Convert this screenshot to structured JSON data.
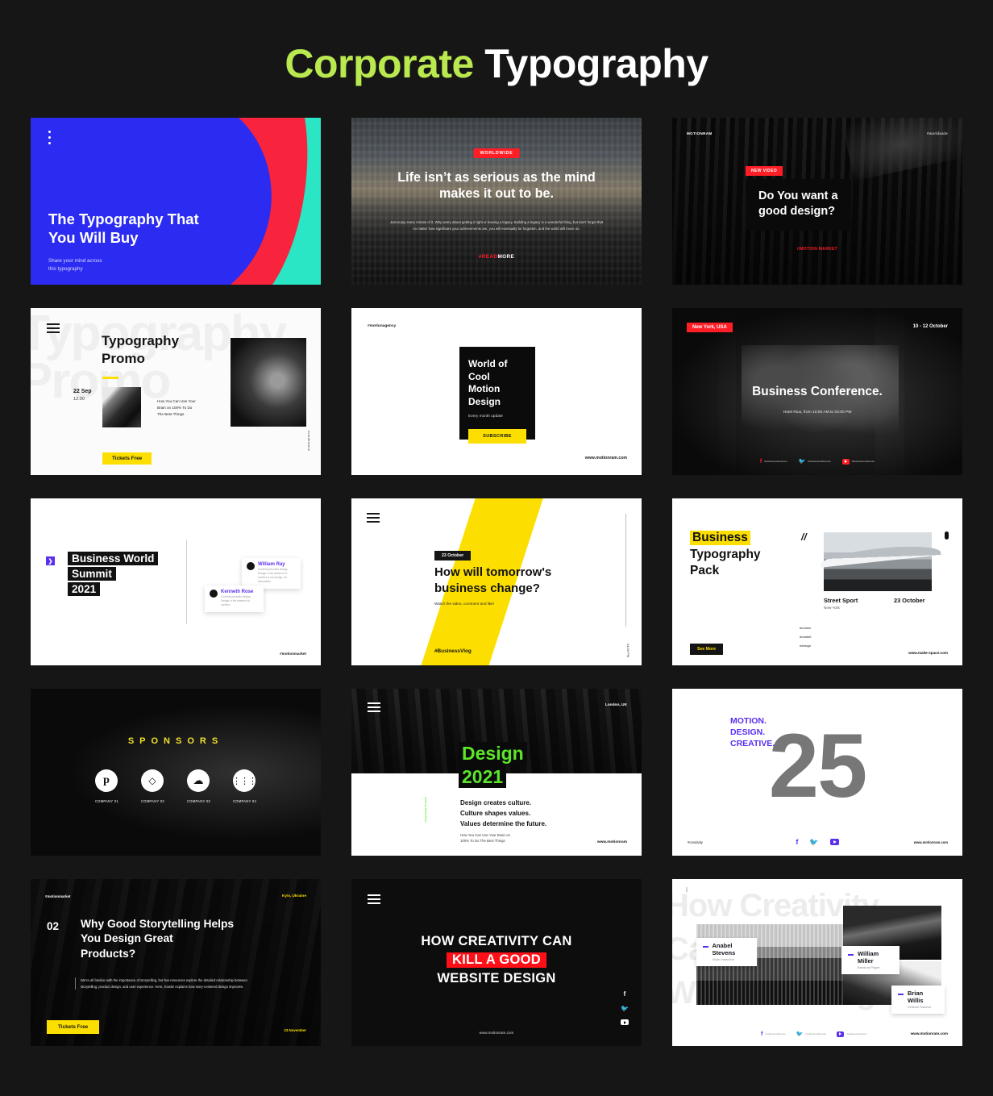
{
  "page": {
    "title_accent": "Corporate",
    "title_plain": "Typography",
    "accent_color": "#b9e94f",
    "background": "#161616"
  },
  "slides": [
    {
      "id": "typography-that-you-will-buy",
      "menu_icon": "vertical-dots-icon",
      "headline": "The Typography That\nYou Will Buy",
      "subtext": "Share your mind across\nthis typography",
      "colors": {
        "bg": "#2b2bf2",
        "shape_red": "#f8233c",
        "shape_teal": "#2ae6c4"
      }
    },
    {
      "id": "life-isnt-as-serious",
      "badge": "WORLDWIDE",
      "headline": "Life isn’t as serious as the mind\nmakes it out to be.",
      "body": "Just enjoy every minute of it. Why worry about getting it right or leaving a legacy. Building a legacy is a wonderful thing, but don’t forget that no matter how significant your achievements are, you will eventually be forgotten, and the world will move on.",
      "cta_accent": "#READ",
      "cta_plain": "MORE",
      "badge_color": "#ff1d26"
    },
    {
      "id": "do-you-want-a-good-design",
      "brand": "MOTIONRAM",
      "tag": "#worldwide",
      "badge": "NEW VIDEO",
      "headline": "Do You want a\ngood design?",
      "footer": "//MOTION MARKET",
      "badge_color": "#ff1d26"
    },
    {
      "id": "typography-promo",
      "menu_icon": "hamburger-icon",
      "watermark": "Typography\nPromo",
      "headline": "Typography\nPromo",
      "date": "22 Sep",
      "time": "12:00",
      "body": "How You Can Use Your\nBrain on 100% To Do\nThe Best Things",
      "button": "Tickets Free",
      "side_tag": "#conference",
      "accent": "#fcdf00"
    },
    {
      "id": "world-of-cool-motion-design",
      "tag": "#motionagency",
      "headline": "World of\nCool\nMotion\nDesign",
      "subtext": "Every month update",
      "button": "SUBSCRIBE",
      "website": "www.motionram.com",
      "accent": "#fcdf00"
    },
    {
      "id": "business-conference",
      "badge": "New York, USA",
      "date": "10 - 12 October",
      "headline": "Business Conference.",
      "subtext": "Hotel Rius, from 10:00 AM to 02:00 PM",
      "socials": [
        {
          "icon": "facebook-icon",
          "label": "/businessconference"
        },
        {
          "icon": "twitter-icon",
          "label": "/businessconference"
        },
        {
          "icon": "youtube-icon",
          "label": "/businessconference"
        }
      ],
      "badge_color": "#ff1d26"
    },
    {
      "id": "business-world-summit-2021",
      "arrow_icon": "chevron-right-icon",
      "headline_lines": [
        "Business World",
        "Summit",
        "2021"
      ],
      "testimonials": [
        {
          "name": "William Ray",
          "text": "Content precedes design. Design in the absence of content is not design, it’s decoration."
        },
        {
          "name": "Kenneth Rose",
          "text": "Content precedes design. Design in the absence of content."
        }
      ],
      "footer_tag": "#motionmarket",
      "accent": "#5b2ff0"
    },
    {
      "id": "how-will-tomorrows-business-change",
      "menu_icon": "hamburger-icon",
      "badge": "23 October",
      "headline": "How will tomorrow's\nbusiness change?",
      "subtext": "Watch the video, comment and like!",
      "footer_tag": "#BusinessVlog",
      "side_time": "04:00 PM",
      "accent": "#fcdf00"
    },
    {
      "id": "business-typography-pack",
      "headline_highlight": "Business",
      "headline_rest": "Typography\nPack",
      "slash": "//",
      "photo_title": "Street Sport",
      "photo_sub": "New-York",
      "photo_date": "23 October",
      "tags": [
        "#motion",
        "#market",
        "#design"
      ],
      "button": "See More",
      "website": "www.make-space.com",
      "accent": "#fcdf00"
    },
    {
      "id": "sponsors",
      "title": "SPONSORS",
      "companies": [
        {
          "icon": "pinterest-icon",
          "label": "COMPANY 01"
        },
        {
          "icon": "box-icon",
          "label": "COMPANY 02"
        },
        {
          "icon": "soundcloud-icon",
          "label": "COMPANY 03"
        },
        {
          "icon": "waveform-icon",
          "label": "COMPANY 04"
        }
      ],
      "accent": "#f2e12a"
    },
    {
      "id": "design-2021",
      "menu_icon": "hamburger-icon",
      "location": "London, UK",
      "headline_lines": [
        "Design",
        "2021"
      ],
      "quote_lines": [
        "Design creates culture.",
        "Culture shapes values.",
        "Values determine the future."
      ],
      "subtext": "How You Can Use Your Brain on\n100% To Do The Best Things",
      "side_tag": "made by MotionRam",
      "website": "www.motionram",
      "accent": "#5ce62a"
    },
    {
      "id": "motion-design-creative-25",
      "headline_lines": [
        "MOTION.",
        "DESIGN.",
        "CREATIVE."
      ],
      "big_number": "25",
      "footer_tag": "#creativity",
      "socials": [
        "facebook-icon",
        "twitter-icon",
        "youtube-icon"
      ],
      "website": "www.motionram.com",
      "accent": "#5b2ff0"
    },
    {
      "id": "why-good-storytelling",
      "tag": "#motionmarket",
      "location": "Kyiv, Ukraine",
      "number": "02",
      "headline": "Why Good Storytelling Helps\nYou Design Great\nProducts?",
      "body": "We’re all familiar with the importance of storytelling, but few resources explore the detailed relationship between storytelling, product design, and user experience. Here, Kowitz explains how story-centered design improves.",
      "button": "Tickets Free",
      "date": "23 November",
      "accent": "#fcdf00"
    },
    {
      "id": "how-creativity-can-kill",
      "menu_icon": "hamburger-icon",
      "line1": "HOW CREATIVITY CAN",
      "line2": "KILL A GOOD",
      "line3": "WEBSITE DESIGN",
      "socials": [
        "facebook-icon",
        "twitter-icon",
        "youtube-icon"
      ],
      "website": "www.motionram.com",
      "highlight": "#ff1018"
    },
    {
      "id": "creativity-team",
      "watermark": "How Creativity\nCan Kill A Good\nWebsite Design",
      "side_tag": "ram ·",
      "people": [
        {
          "name": "Anabel Stevens",
          "role": "Violin Instructor"
        },
        {
          "name": "William Miller",
          "role": "Bandura Player"
        },
        {
          "name": "Brian Willis",
          "role": "Violinist Teacher"
        }
      ],
      "socials": [
        {
          "icon": "facebook-icon",
          "label": "/motionconference"
        },
        {
          "icon": "twitter-icon",
          "label": "/motionconference"
        },
        {
          "icon": "youtube-icon",
          "label": "/motionconference"
        }
      ],
      "website": "www.motionram.com",
      "accent": "#5b2ff0"
    }
  ]
}
